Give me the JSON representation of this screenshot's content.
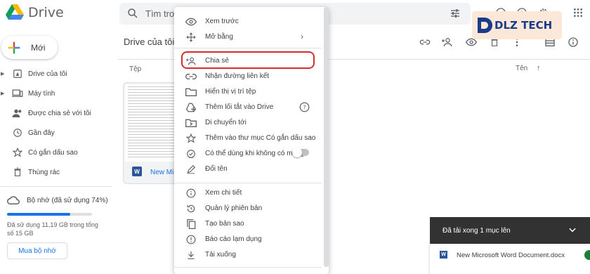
{
  "app": {
    "name": "Drive"
  },
  "search": {
    "placeholder": "Tìm trong Drive"
  },
  "sidebar": {
    "new_label": "Mới",
    "items": [
      {
        "label": "Drive của tôi",
        "icon": "drive-icon"
      },
      {
        "label": "Máy tính",
        "icon": "computer-icon"
      },
      {
        "label": "Được chia sẻ với tôi",
        "icon": "shared-icon"
      },
      {
        "label": "Gần đây",
        "icon": "clock-icon"
      },
      {
        "label": "Có gắn dấu sao",
        "icon": "star-icon"
      },
      {
        "label": "Thùng rác",
        "icon": "trash-icon"
      }
    ],
    "storage": {
      "label": "Bộ nhớ (đã sử dụng 74%)",
      "percent_used": 74,
      "detail": "Đã sử dụng 11,19 GB trong tổng số 15 GB",
      "buy_label": "Mua bộ nhớ"
    }
  },
  "main": {
    "title": "Drive của tôi",
    "column_files": "Tệp",
    "sort_label": "Tên",
    "file_name": "New Microsoft Word Document.docx"
  },
  "context_menu": {
    "groups": [
      [
        {
          "label": "Xem trước",
          "icon": "eye-icon"
        },
        {
          "label": "Mở bằng",
          "icon": "move-arrows-icon",
          "submenu": true
        }
      ],
      [
        {
          "label": "Chia sẻ",
          "icon": "share-person-icon",
          "highlighted": true
        },
        {
          "label": "Nhận đường liên kết",
          "icon": "link-icon"
        },
        {
          "label": "Hiển thị vị trí tệp",
          "icon": "folder-icon"
        },
        {
          "label": "Thêm lối tắt vào Drive",
          "icon": "add-shortcut-icon",
          "help": true
        },
        {
          "label": "Di chuyển tới",
          "icon": "move-to-folder-icon"
        },
        {
          "label": "Thêm vào thư mục Có gắn dấu sao",
          "icon": "star-icon"
        },
        {
          "label": "Có thể dùng khi không có mạng",
          "icon": "offline-icon",
          "toggle": true
        },
        {
          "label": "Đổi tên",
          "icon": "pencil-icon"
        }
      ],
      [
        {
          "label": "Xem chi tiết",
          "icon": "info-icon"
        },
        {
          "label": "Quản lý phiên bản",
          "icon": "history-icon"
        },
        {
          "label": "Tạo bản sao",
          "icon": "copy-icon"
        },
        {
          "label": "Báo cáo lạm dụng",
          "icon": "report-icon"
        },
        {
          "label": "Tải xuống",
          "icon": "download-icon"
        }
      ]
    ]
  },
  "upload_toast": {
    "title": "Đã tải xong 1 mục lên",
    "file_name": "New Microsoft Word Document.docx"
  },
  "watermark": {
    "text": "DLZ TECH"
  },
  "colors": {
    "accent": "#1a73e8",
    "highlight_ring": "#d32f2f",
    "toast_bg": "#323232"
  }
}
